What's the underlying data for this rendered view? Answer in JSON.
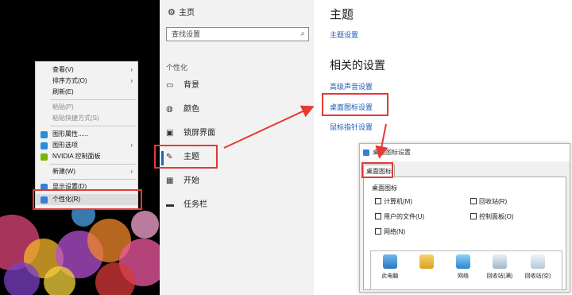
{
  "colors": {
    "highlight_red": "#e53935",
    "link_blue": "#1a5fb4",
    "accent": "#0f6cbd"
  },
  "context_menu": {
    "items": [
      {
        "label": "查看(V)",
        "submenu": true,
        "disabled": false
      },
      {
        "label": "排序方式(O)",
        "submenu": true,
        "disabled": false
      },
      {
        "label": "刷新(E)",
        "submenu": false,
        "disabled": false
      },
      {
        "label": "粘贴(P)",
        "submenu": false,
        "disabled": true
      },
      {
        "label": "粘贴快捷方式(S)",
        "submenu": false,
        "disabled": true
      },
      {
        "label": "图形属性......",
        "submenu": false,
        "disabled": false,
        "icon": "intel-graphics-icon"
      },
      {
        "label": "图形选项",
        "submenu": true,
        "disabled": false,
        "icon": "intel-graphics-icon"
      },
      {
        "label": "NVIDIA 控制面板",
        "submenu": false,
        "disabled": false,
        "icon": "nvidia-icon"
      },
      {
        "label": "新建(W)",
        "submenu": true,
        "disabled": false
      },
      {
        "label": "显示设置(D)",
        "submenu": false,
        "disabled": false,
        "icon": "display-icon"
      },
      {
        "label": "个性化(R)",
        "submenu": false,
        "disabled": false,
        "icon": "personalize-icon"
      }
    ]
  },
  "sidebar": {
    "home_label": "主页",
    "home_icon": "gear-icon",
    "search_placeholder": "查找设置",
    "search_icon": "search-icon",
    "section_label": "个性化",
    "items": [
      {
        "label": "背景",
        "icon": "picture-icon"
      },
      {
        "label": "颜色",
        "icon": "palette-icon"
      },
      {
        "label": "锁屏界面",
        "icon": "lockscreen-icon"
      },
      {
        "label": "主题",
        "icon": "brush-icon",
        "active": true
      },
      {
        "label": "开始",
        "icon": "grid-icon"
      },
      {
        "label": "任务栏",
        "icon": "taskbar-icon"
      }
    ]
  },
  "content": {
    "title": "主题",
    "theme_settings_link": "主题设置",
    "related_heading": "相关的设置",
    "links": [
      "高级声音设置",
      "桌面图标设置",
      "鼠标指针设置"
    ]
  },
  "dialog": {
    "title": "桌面图标设置",
    "tab": "桌面图标",
    "group_label": "桌面图标",
    "checkboxes": [
      {
        "label": "计算机(M)"
      },
      {
        "label": "回收站(R)"
      },
      {
        "label": "用户的文件(U)"
      },
      {
        "label": "控制面板(O)"
      },
      {
        "label": "网络(N)"
      }
    ],
    "icons": [
      {
        "label": "此电脑",
        "icon": "computer-icon"
      },
      {
        "label": "",
        "icon": "user-folder-icon"
      },
      {
        "label": "网络",
        "icon": "network-icon"
      },
      {
        "label": "回收站(满)",
        "icon": "recycle-bin-full-icon"
      },
      {
        "label": "回收站(空)",
        "icon": "recycle-bin-empty-icon"
      }
    ]
  }
}
